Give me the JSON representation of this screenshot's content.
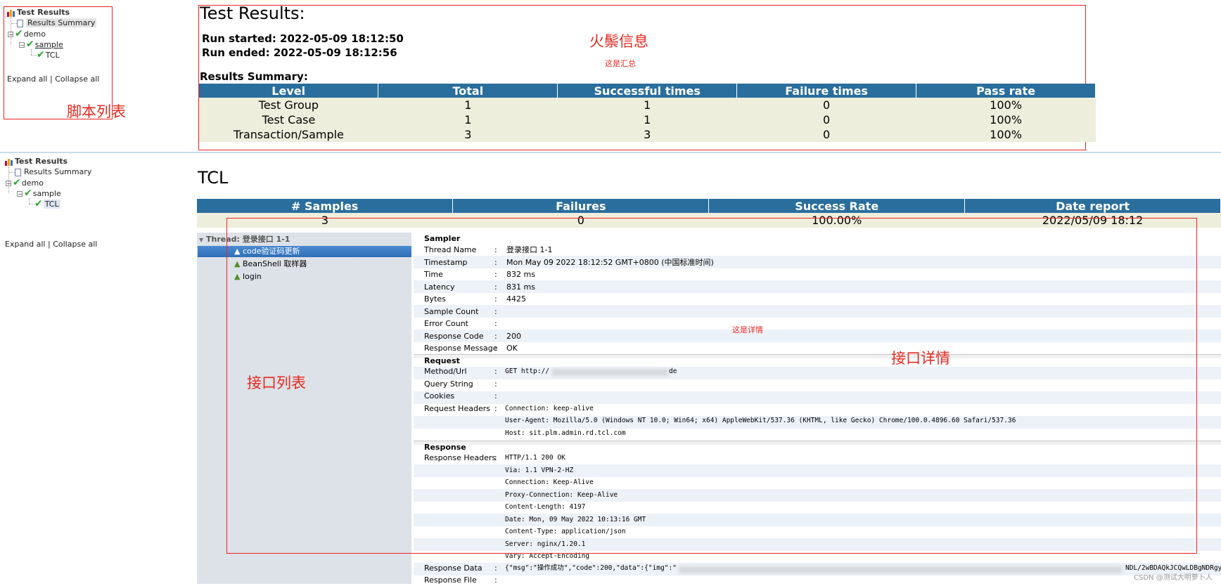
{
  "tree": {
    "root": "Test Results",
    "summary": "Results Summary",
    "demo": "demo",
    "sample": "sample",
    "tcl": "TCL",
    "expand_all": "Expand all",
    "separator": "|",
    "collapse_all": "Collapse all"
  },
  "annotations": {
    "script_list": "脚本列表",
    "fire_info": "火鬃信息",
    "summary_note": "这是汇总",
    "api_list": "接口列表",
    "detail_note": "这是详情",
    "api_detail": "接口详情"
  },
  "summary": {
    "title": "Test Results:",
    "run_started": "Run started: 2022-05-09 18:12:50",
    "run_ended": "Run ended: 2022-05-09 18:12:56",
    "section": "Results Summary:",
    "columns": [
      "Level",
      "Total",
      "Successful times",
      "Failure times",
      "Pass rate"
    ],
    "rows": [
      [
        "Test Group",
        "1",
        "1",
        "0",
        "100%"
      ],
      [
        "Test Case",
        "1",
        "1",
        "0",
        "100%"
      ],
      [
        "Transaction/Sample",
        "3",
        "3",
        "0",
        "100%"
      ]
    ]
  },
  "tcl": {
    "title": "TCL",
    "columns": [
      "# Samples",
      "Failures",
      "Success Rate",
      "Date report"
    ],
    "values": [
      "3",
      "0",
      "100.00%",
      "2022/05/09 18:12"
    ]
  },
  "samples": {
    "thread": "Thread: 登录接口 1-1",
    "items": [
      "code验证码更新",
      "BeanShell 取样器",
      "login"
    ]
  },
  "detail": {
    "sampler_title": "Sampler",
    "sampler": [
      [
        "Thread Name",
        "登录接口 1-1"
      ],
      [
        "Timestamp",
        "Mon May 09 2022 18:12:52 GMT+0800 (中国标准时间)"
      ],
      [
        "Time",
        "832 ms"
      ],
      [
        "Latency",
        "831 ms"
      ],
      [
        "Bytes",
        "4425"
      ],
      [
        "Sample Count",
        ""
      ],
      [
        "Error Count",
        ""
      ],
      [
        "Response Code",
        "200"
      ],
      [
        "Response Message",
        "OK"
      ]
    ],
    "request_title": "Request",
    "method_label": "Method/Url",
    "method_value": "GET http://",
    "method_tail": "de",
    "query_label": "Query String",
    "cookies_label": "Cookies",
    "req_headers_label": "Request Headers",
    "req_headers": [
      "Connection: keep-alive",
      "User-Agent: Mozilla/5.0 (Windows NT 10.0; Win64; x64) AppleWebKit/537.36 (KHTML, like Gecko) Chrome/100.0.4896.60 Safari/537.36",
      "Host: sit.plm.admin.rd.tcl.com"
    ],
    "response_title": "Response",
    "resp_headers_label": "Response Headers",
    "resp_headers": [
      "HTTP/1.1 200 OK",
      "Via: 1.1 VPN-2-HZ",
      "Connection: Keep-Alive",
      "Proxy-Connection: Keep-Alive",
      "Content-Length: 4197",
      "Date: Mon, 09 May 2022 10:13:16 GMT",
      "Content-Type: application/json",
      "Server: nginx/1.20.1",
      "Vary: Accept-Encoding"
    ],
    "resp_data_label": "Response Data",
    "resp_data_value": "{\"msg\":\"操作成功\",\"code\":200,\"data\":{\"img\":\"",
    "resp_data_tail": "NDL/2wBDAQkJCQwLDBgNDRgy",
    "resp_file_label": "Response File",
    "colon": ":",
    "watermark": "CSDN @测试大明萝卜人"
  }
}
